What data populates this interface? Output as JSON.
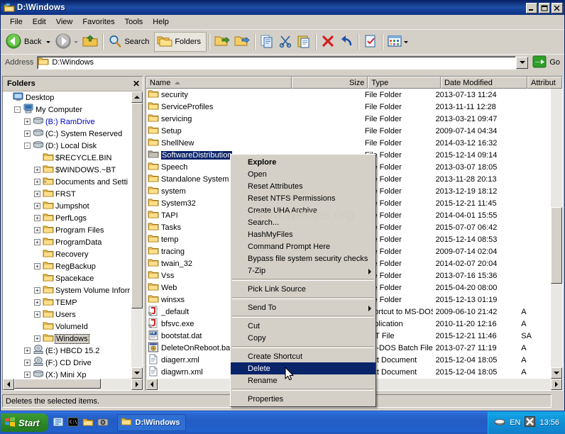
{
  "window": {
    "title": "D:\\Windows",
    "icon": "folder-window-icon",
    "buttons": {
      "minimize": "_",
      "maximize": "❐",
      "close": "✕"
    }
  },
  "menubar": {
    "items": [
      "File",
      "Edit",
      "View",
      "Favorites",
      "Tools",
      "Help"
    ]
  },
  "toolbar": {
    "back_label": "Back",
    "forward_label": "",
    "up_label": "",
    "search_label": "Search",
    "folders_label": "Folders"
  },
  "address": {
    "label": "Address",
    "value": "D:\\Windows",
    "go_label": "Go"
  },
  "folders_pane": {
    "title": "Folders",
    "close": "✕",
    "items": [
      {
        "label": "Desktop",
        "indent": 0,
        "expander": "",
        "icon": "desktop-icon",
        "style": "normal"
      },
      {
        "label": "My Computer",
        "indent": 1,
        "expander": "-",
        "icon": "computer-icon",
        "style": "normal"
      },
      {
        "label": "(B:) RamDrive",
        "indent": 2,
        "expander": "+",
        "icon": "drive-icon",
        "style": "blue"
      },
      {
        "label": "(C:) System Reserved",
        "indent": 2,
        "expander": "+",
        "icon": "drive-icon",
        "style": "normal"
      },
      {
        "label": "(D:) Local Disk",
        "indent": 2,
        "expander": "-",
        "icon": "drive-icon",
        "style": "normal"
      },
      {
        "label": "$RECYCLE.BIN",
        "indent": 3,
        "expander": "",
        "icon": "folder-icon",
        "style": "normal"
      },
      {
        "label": "$WINDOWS.~BT",
        "indent": 3,
        "expander": "+",
        "icon": "folder-icon",
        "style": "normal"
      },
      {
        "label": "Documents and Setti",
        "indent": 3,
        "expander": "+",
        "icon": "folder-share-icon",
        "style": "normal"
      },
      {
        "label": "FRST",
        "indent": 3,
        "expander": "+",
        "icon": "folder-icon",
        "style": "normal"
      },
      {
        "label": "Jumpshot",
        "indent": 3,
        "expander": "+",
        "icon": "folder-icon",
        "style": "normal"
      },
      {
        "label": "PerfLogs",
        "indent": 3,
        "expander": "+",
        "icon": "folder-icon",
        "style": "normal"
      },
      {
        "label": "Program Files",
        "indent": 3,
        "expander": "+",
        "icon": "folder-icon",
        "style": "normal"
      },
      {
        "label": "ProgramData",
        "indent": 3,
        "expander": "+",
        "icon": "folder-icon",
        "style": "normal"
      },
      {
        "label": "Recovery",
        "indent": 3,
        "expander": "",
        "icon": "folder-icon",
        "style": "normal"
      },
      {
        "label": "RegBackup",
        "indent": 3,
        "expander": "+",
        "icon": "folder-icon",
        "style": "normal"
      },
      {
        "label": "Spacekace",
        "indent": 3,
        "expander": "",
        "icon": "folder-icon",
        "style": "normal"
      },
      {
        "label": "System Volume Inforr",
        "indent": 3,
        "expander": "+",
        "icon": "folder-icon",
        "style": "normal"
      },
      {
        "label": "TEMP",
        "indent": 3,
        "expander": "+",
        "icon": "folder-icon",
        "style": "normal"
      },
      {
        "label": "Users",
        "indent": 3,
        "expander": "+",
        "icon": "folder-icon",
        "style": "normal"
      },
      {
        "label": "VolumeId",
        "indent": 3,
        "expander": "",
        "icon": "folder-icon",
        "style": "normal"
      },
      {
        "label": "Windows",
        "indent": 3,
        "expander": "+",
        "icon": "folder-icon",
        "style": "selected"
      },
      {
        "label": "(E:) HBCD 15.2",
        "indent": 2,
        "expander": "+",
        "icon": "cd-icon",
        "style": "normal"
      },
      {
        "label": "(F:) CD Drive",
        "indent": 2,
        "expander": "+",
        "icon": "cd-icon",
        "style": "normal"
      },
      {
        "label": "(X:) Mini Xp",
        "indent": 2,
        "expander": "+",
        "icon": "drive-icon",
        "style": "normal"
      }
    ]
  },
  "file_list": {
    "columns": [
      {
        "label": "Name",
        "align": "left",
        "sorted": true
      },
      {
        "label": "Size",
        "align": "right",
        "sorted": false
      },
      {
        "label": "Type",
        "align": "left",
        "sorted": false
      },
      {
        "label": "Date Modified",
        "align": "left",
        "sorted": false
      },
      {
        "label": "Attribut",
        "align": "left",
        "sorted": false
      }
    ],
    "rows": [
      {
        "name": "security",
        "icon": "folder-icon",
        "size": "",
        "type": "File Folder",
        "date": "2013-07-13 11:24",
        "attr": "",
        "selected": false
      },
      {
        "name": "ServiceProfiles",
        "icon": "folder-icon",
        "size": "",
        "type": "File Folder",
        "date": "2013-11-11 12:28",
        "attr": "",
        "selected": false
      },
      {
        "name": "servicing",
        "icon": "folder-icon",
        "size": "",
        "type": "File Folder",
        "date": "2013-03-21 09:47",
        "attr": "",
        "selected": false
      },
      {
        "name": "Setup",
        "icon": "folder-icon",
        "size": "",
        "type": "File Folder",
        "date": "2009-07-14 04:34",
        "attr": "",
        "selected": false
      },
      {
        "name": "ShellNew",
        "icon": "folder-icon",
        "size": "",
        "type": "File Folder",
        "date": "2014-03-12 16:32",
        "attr": "",
        "selected": false
      },
      {
        "name": "SoftwareDistribution",
        "icon": "folder-dim-icon",
        "size": "",
        "type": "File Folder",
        "date": "2015-12-14 09:14",
        "attr": "",
        "selected": true
      },
      {
        "name": "Speech",
        "icon": "folder-icon",
        "size": "",
        "type": "File Folder",
        "date": "2013-03-07 18:05",
        "attr": "",
        "selected": false
      },
      {
        "name": "Standalone System",
        "icon": "folder-icon",
        "size": "",
        "type": "File Folder",
        "date": "2013-11-28 20:13",
        "attr": "",
        "selected": false
      },
      {
        "name": "system",
        "icon": "folder-icon",
        "size": "",
        "type": "File Folder",
        "date": "2013-12-19 18:12",
        "attr": "",
        "selected": false
      },
      {
        "name": "System32",
        "icon": "folder-icon",
        "size": "",
        "type": "File Folder",
        "date": "2015-12-21 11:45",
        "attr": "",
        "selected": false
      },
      {
        "name": "TAPI",
        "icon": "folder-icon",
        "size": "",
        "type": "File Folder",
        "date": "2014-04-01 15:55",
        "attr": "",
        "selected": false
      },
      {
        "name": "Tasks",
        "icon": "folder-icon",
        "size": "",
        "type": "File Folder",
        "date": "2015-07-07 06:42",
        "attr": "",
        "selected": false
      },
      {
        "name": "temp",
        "icon": "folder-icon",
        "size": "",
        "type": "File Folder",
        "date": "2015-12-14 08:53",
        "attr": "",
        "selected": false
      },
      {
        "name": "tracing",
        "icon": "folder-icon",
        "size": "",
        "type": "File Folder",
        "date": "2009-07-14 02:04",
        "attr": "",
        "selected": false
      },
      {
        "name": "twain_32",
        "icon": "folder-icon",
        "size": "",
        "type": "File Folder",
        "date": "2014-02-07 20:04",
        "attr": "",
        "selected": false
      },
      {
        "name": "Vss",
        "icon": "folder-icon",
        "size": "",
        "type": "File Folder",
        "date": "2013-07-16 15:36",
        "attr": "",
        "selected": false
      },
      {
        "name": "Web",
        "icon": "folder-icon",
        "size": "",
        "type": "File Folder",
        "date": "2015-04-20 08:00",
        "attr": "",
        "selected": false
      },
      {
        "name": "winsxs",
        "icon": "folder-icon",
        "size": "",
        "type": "File Folder",
        "date": "2015-12-13 01:19",
        "attr": "",
        "selected": false
      },
      {
        "name": "_default",
        "icon": "shortcut-icon",
        "size": "",
        "type": "Shortcut to MS-DOS...",
        "date": "2009-06-10 21:42",
        "attr": "A",
        "selected": false
      },
      {
        "name": "bfsvc.exe",
        "icon": "shortcut-icon",
        "size": "",
        "type": "Application",
        "date": "2010-11-20 12:16",
        "attr": "A",
        "selected": false
      },
      {
        "name": "bootstat.dat",
        "icon": "dat-icon",
        "size": "",
        "type": "DAT File",
        "date": "2015-12-21 11:46",
        "attr": "SA",
        "selected": false
      },
      {
        "name": "DeleteOnReboot.ba",
        "icon": "bat-icon",
        "size": "",
        "type": "MS-DOS Batch File",
        "date": "2013-07-27 11:19",
        "attr": "A",
        "selected": false
      },
      {
        "name": "diagerr.xml",
        "icon": "xml-icon",
        "size": "",
        "type": "Text Document",
        "date": "2015-12-04 18:05",
        "attr": "A",
        "selected": false
      },
      {
        "name": "diagwrn.xml",
        "icon": "xml-icon",
        "size": "",
        "type": "Text Document",
        "date": "2015-12-04 18:05",
        "attr": "A",
        "selected": false
      }
    ]
  },
  "context_menu": {
    "items": [
      {
        "label": "Explore",
        "type": "item",
        "bold": true,
        "submenu": false,
        "highlighted": false
      },
      {
        "label": "Open",
        "type": "item",
        "bold": false,
        "submenu": false,
        "highlighted": false
      },
      {
        "label": "Reset Attributes",
        "type": "item",
        "bold": false,
        "submenu": false,
        "highlighted": false
      },
      {
        "label": "Reset NTFS Permissions",
        "type": "item",
        "bold": false,
        "submenu": false,
        "highlighted": false
      },
      {
        "label": "Create UHA Archive",
        "type": "item",
        "bold": false,
        "submenu": false,
        "highlighted": false
      },
      {
        "label": "Search...",
        "type": "item",
        "bold": false,
        "submenu": false,
        "highlighted": false
      },
      {
        "label": "HashMyFiles",
        "type": "item",
        "bold": false,
        "submenu": false,
        "highlighted": false
      },
      {
        "label": "Command Prompt Here",
        "type": "item",
        "bold": false,
        "submenu": false,
        "highlighted": false
      },
      {
        "label": "Bypass file system security checks",
        "type": "item",
        "bold": false,
        "submenu": false,
        "highlighted": false
      },
      {
        "label": "7-Zip",
        "type": "item",
        "bold": false,
        "submenu": true,
        "highlighted": false
      },
      {
        "label": "",
        "type": "separator"
      },
      {
        "label": "Pick Link Source",
        "type": "item",
        "bold": false,
        "submenu": false,
        "highlighted": false
      },
      {
        "label": "",
        "type": "separator"
      },
      {
        "label": "Send To",
        "type": "item",
        "bold": false,
        "submenu": true,
        "highlighted": false
      },
      {
        "label": "",
        "type": "separator"
      },
      {
        "label": "Cut",
        "type": "item",
        "bold": false,
        "submenu": false,
        "highlighted": false
      },
      {
        "label": "Copy",
        "type": "item",
        "bold": false,
        "submenu": false,
        "highlighted": false
      },
      {
        "label": "",
        "type": "separator"
      },
      {
        "label": "Create Shortcut",
        "type": "item",
        "bold": false,
        "submenu": false,
        "highlighted": false
      },
      {
        "label": "Delete",
        "type": "item",
        "bold": false,
        "submenu": false,
        "highlighted": true
      },
      {
        "label": "Rename",
        "type": "item",
        "bold": false,
        "submenu": false,
        "highlighted": false
      },
      {
        "label": "",
        "type": "separator"
      },
      {
        "label": "Properties",
        "type": "item",
        "bold": false,
        "submenu": false,
        "highlighted": false
      }
    ]
  },
  "watermark": "www.wintips.org",
  "statusbar": {
    "text": "Deletes the selected items."
  },
  "taskbar": {
    "start_label": "Start",
    "quick_launch": [
      "explorer-icon",
      "console-icon",
      "folder-icon",
      "camera-icon"
    ],
    "tasks": [
      {
        "label": "D:\\Windows",
        "icon": "folder-icon",
        "active": true
      }
    ],
    "tray": {
      "network_icon": "network-icon",
      "language": "EN",
      "shield_icon": "security-shield-icon",
      "clock": "13:56"
    }
  },
  "colors": {
    "title_bar_start": "#0a246a",
    "title_bar_end": "#1d4ea0",
    "face": "#d4d0c8",
    "selection": "#0a246a",
    "folder_yellow": "#fcd56a",
    "link_blue": "#0000c8",
    "taskbar_blue": "#2160cd",
    "start_green": "#2f8a28"
  }
}
